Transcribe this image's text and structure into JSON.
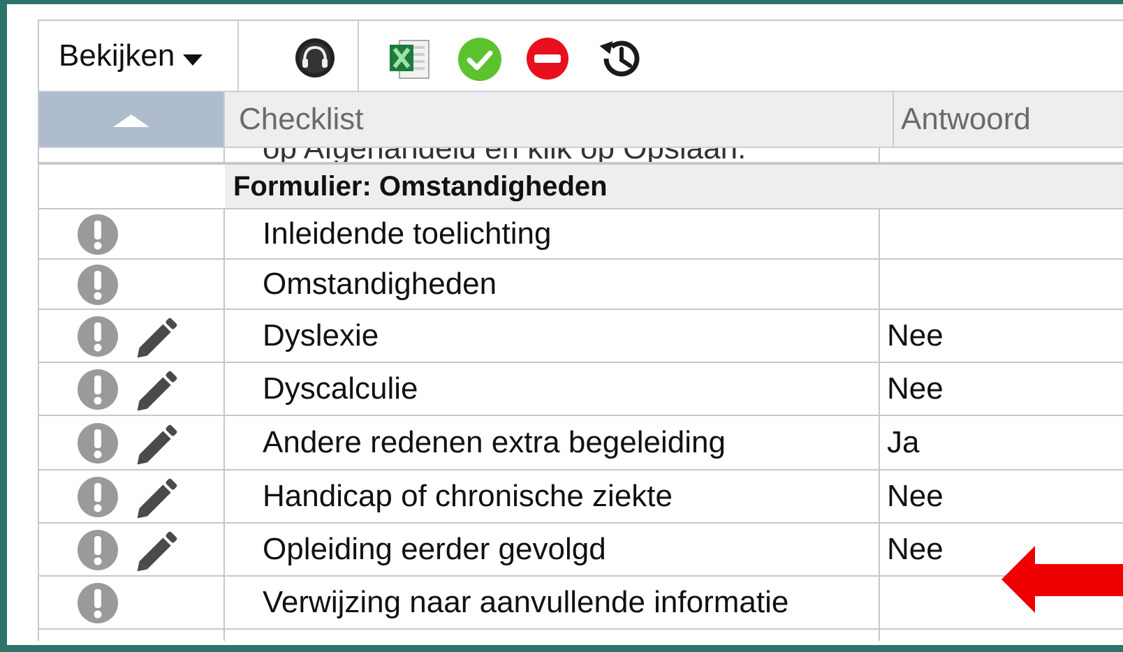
{
  "toolbar": {
    "view_label": "Bekijken",
    "icons": [
      "headset-icon",
      "excel-icon",
      "approve-icon",
      "reject-icon",
      "history-icon"
    ]
  },
  "table": {
    "columns": [
      "Checklist",
      "Antwoord"
    ],
    "partial_row_text": "op Afgehandeld en klik op Opslaan.",
    "group_title": "Formulier: Omstandigheden",
    "rows": [
      {
        "label": "Inleidende toelichting",
        "answer": "",
        "editable": false
      },
      {
        "label": "Omstandigheden",
        "answer": "",
        "editable": false
      },
      {
        "label": "Dyslexie",
        "answer": "Nee",
        "editable": true
      },
      {
        "label": "Dyscalculie",
        "answer": "Nee",
        "editable": true
      },
      {
        "label": "Andere redenen extra begeleiding",
        "answer": "Ja",
        "editable": true
      },
      {
        "label": "Handicap of chronische ziekte",
        "answer": "Nee",
        "editable": true
      },
      {
        "label": "Opleiding eerder gevolgd",
        "answer": "Nee",
        "editable": true
      },
      {
        "label": "Verwijzing naar aanvullende informatie",
        "answer": "",
        "editable": false
      }
    ]
  },
  "colors": {
    "frame": "#2e726c",
    "sort_header": "#aebccd",
    "approve": "#5cc22e",
    "reject": "#e8101e",
    "warning_icon": "#9a9a9a",
    "annotation_arrow": "#ee0000"
  }
}
